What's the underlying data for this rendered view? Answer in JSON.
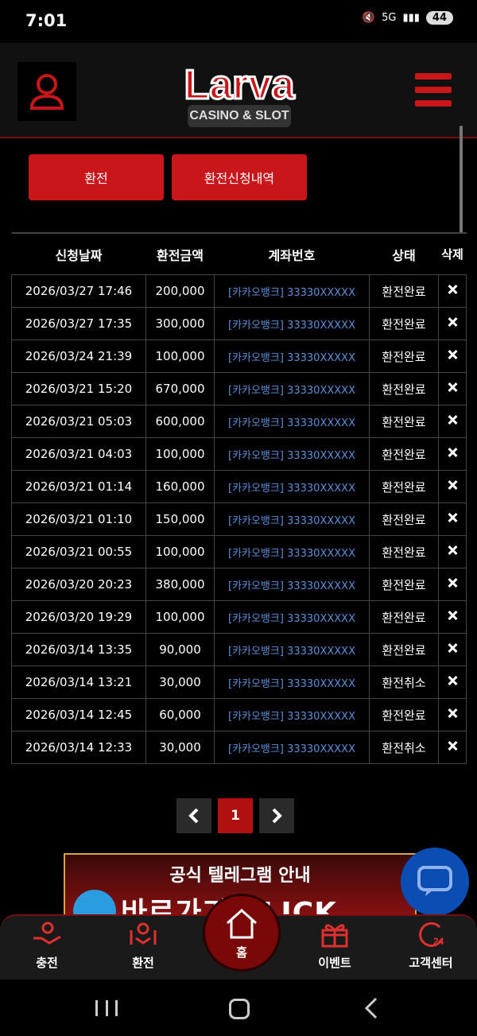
{
  "status_bar": {
    "time": "7:01",
    "network": "5G",
    "battery": "44"
  },
  "header": {
    "logo_text": "Larva",
    "logo_subtext": "CASINO & SLOT"
  },
  "tabs": [
    {
      "label": "환전"
    },
    {
      "label": "환전신청내역"
    }
  ],
  "table": {
    "columns": [
      "신청날짜",
      "환전금액",
      "계좌번호",
      "상태",
      "삭제"
    ],
    "rows": [
      {
        "date": "2026/03/27 17:46",
        "amount": "200,000",
        "account": "[카카오뱅크] 33330XXXXX",
        "status": "환전완료"
      },
      {
        "date": "2026/03/27 17:35",
        "amount": "300,000",
        "account": "[카카오뱅크] 33330XXXXX",
        "status": "환전완료"
      },
      {
        "date": "2026/03/24 21:39",
        "amount": "100,000",
        "account": "[카카오뱅크] 33330XXXXX",
        "status": "환전완료"
      },
      {
        "date": "2026/03/21 15:20",
        "amount": "670,000",
        "account": "[카카오뱅크] 33330XXXXX",
        "status": "환전완료"
      },
      {
        "date": "2026/03/21 05:03",
        "amount": "600,000",
        "account": "[카카오뱅크] 33330XXXXX",
        "status": "환전완료"
      },
      {
        "date": "2026/03/21 04:03",
        "amount": "100,000",
        "account": "[카카오뱅크] 33330XXXXX",
        "status": "환전완료"
      },
      {
        "date": "2026/03/21 01:14",
        "amount": "160,000",
        "account": "[카카오뱅크] 33330XXXXX",
        "status": "환전완료"
      },
      {
        "date": "2026/03/21 01:10",
        "amount": "150,000",
        "account": "[카카오뱅크] 33330XXXXX",
        "status": "환전완료"
      },
      {
        "date": "2026/03/21 00:55",
        "amount": "100,000",
        "account": "[카카오뱅크] 33330XXXXX",
        "status": "환전완료"
      },
      {
        "date": "2026/03/20 20:23",
        "amount": "380,000",
        "account": "[카카오뱅크] 33330XXXXX",
        "status": "환전완료"
      },
      {
        "date": "2026/03/20 19:29",
        "amount": "100,000",
        "account": "[카카오뱅크] 33330XXXXX",
        "status": "환전완료"
      },
      {
        "date": "2026/03/14 13:35",
        "amount": "90,000",
        "account": "[카카오뱅크] 33330XXXXX",
        "status": "환전완료"
      },
      {
        "date": "2026/03/14 13:21",
        "amount": "30,000",
        "account": "[카카오뱅크] 33330XXXXX",
        "status": "환전취소"
      },
      {
        "date": "2026/03/14 12:45",
        "amount": "60,000",
        "account": "[카카오뱅크] 33330XXXXX",
        "status": "환전완료"
      },
      {
        "date": "2026/03/14 12:33",
        "amount": "30,000",
        "account": "[카카오뱅크] 33330XXXXX",
        "status": "환전취소"
      }
    ]
  },
  "pagination": {
    "current": "1"
  },
  "banner": {
    "title": "공식 텔레그램 안내",
    "subtitle": "바로가기 CLICK"
  },
  "bottom_nav": [
    {
      "label": "충전"
    },
    {
      "label": "환전"
    },
    {
      "label": "홈"
    },
    {
      "label": "이벤트"
    },
    {
      "label": "고객센터"
    }
  ],
  "colors": {
    "accent": "#c8161a",
    "background": "#000000",
    "link": "#5a8fd8"
  }
}
